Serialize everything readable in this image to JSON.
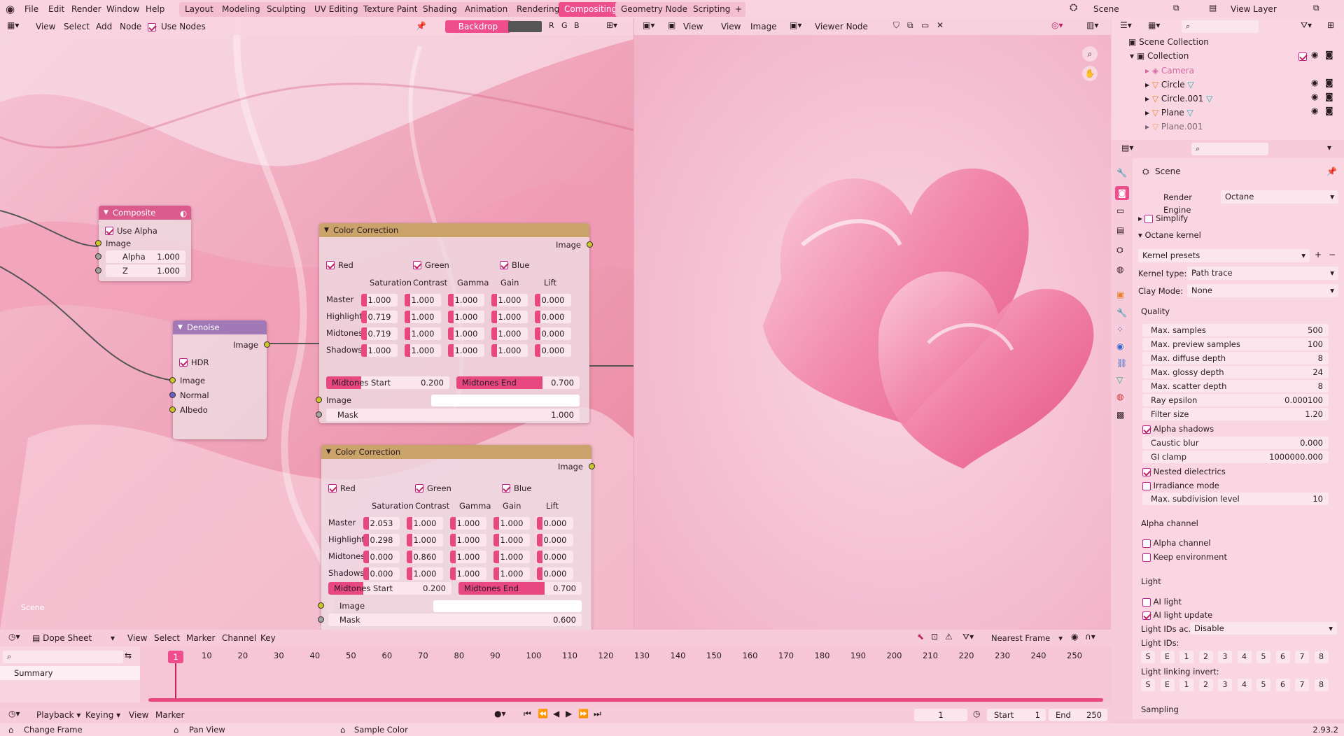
{
  "menubar": {
    "items": [
      "File",
      "Edit",
      "Render",
      "Window",
      "Help"
    ],
    "workspaces": [
      "Layout",
      "Modeling",
      "Sculpting",
      "UV Editing",
      "Texture Paint",
      "Shading",
      "Animation",
      "Rendering",
      "Compositing",
      "Geometry Nodes",
      "Scripting"
    ],
    "active_workspace": "Compositing",
    "scene_name": "Scene",
    "view_layer": "View Layer"
  },
  "node_editor": {
    "menus": [
      "View",
      "Select",
      "Add",
      "Node"
    ],
    "use_nodes_label": "Use Nodes",
    "backdrop_label": "Backdrop",
    "channel_buttons": [
      "R",
      "G",
      "B"
    ],
    "scene_label": "Scene"
  },
  "image_editor": {
    "menus": [
      "View",
      "View",
      "Image"
    ],
    "viewer_node": "Viewer Node"
  },
  "composite_node": {
    "title": "Composite",
    "use_alpha": "Use Alpha",
    "image": "Image",
    "alpha_label": "Alpha",
    "alpha_value": "1.000",
    "z_label": "Z",
    "z_value": "1.000"
  },
  "denoise_node": {
    "title": "Denoise",
    "out_image": "Image",
    "hdr": "HDR",
    "inputs": [
      "Image",
      "Normal",
      "Albedo"
    ]
  },
  "cc_nodes": [
    {
      "title": "Color Correction",
      "out_image": "Image",
      "channels": [
        "Red",
        "Green",
        "Blue"
      ],
      "columns": [
        "Saturation",
        "Contrast",
        "Gamma",
        "Gain",
        "Lift"
      ],
      "rows": [
        {
          "label": "Master",
          "values": [
            "1.000",
            "1.000",
            "1.000",
            "1.000",
            "0.000"
          ]
        },
        {
          "label": "Highlights",
          "values": [
            "0.719",
            "1.000",
            "1.000",
            "1.000",
            "0.000"
          ]
        },
        {
          "label": "Midtones",
          "values": [
            "0.719",
            "1.000",
            "1.000",
            "1.000",
            "0.000"
          ]
        },
        {
          "label": "Shadows",
          "values": [
            "1.000",
            "1.000",
            "1.000",
            "1.000",
            "0.000"
          ]
        }
      ],
      "midtones_start_label": "Midtones Start",
      "midtones_start": "0.200",
      "midtones_end_label": "Midtones End",
      "midtones_end": "0.700",
      "in_image": "Image",
      "mask_label": "Mask",
      "mask": "1.000"
    },
    {
      "title": "Color Correction",
      "out_image": "Image",
      "channels": [
        "Red",
        "Green",
        "Blue"
      ],
      "columns": [
        "Saturation",
        "Contrast",
        "Gamma",
        "Gain",
        "Lift"
      ],
      "rows": [
        {
          "label": "Master",
          "values": [
            "2.053",
            "1.000",
            "1.000",
            "1.000",
            "0.000"
          ]
        },
        {
          "label": "Highlights",
          "values": [
            "0.298",
            "1.000",
            "1.000",
            "1.000",
            "0.000"
          ]
        },
        {
          "label": "Midtones",
          "values": [
            "0.000",
            "0.860",
            "1.000",
            "1.000",
            "0.000"
          ]
        },
        {
          "label": "Shadows",
          "values": [
            "0.000",
            "1.000",
            "1.000",
            "1.000",
            "0.000"
          ]
        }
      ],
      "midtones_start_label": "Midtones Start",
      "midtones_start": "0.200",
      "midtones_end_label": "Midtones End",
      "midtones_end": "0.700",
      "in_image": "Image",
      "mask_label": "Mask",
      "mask": "0.600"
    }
  ],
  "outliner": {
    "scene_collection": "Scene Collection",
    "collection": "Collection",
    "items": [
      "Camera",
      "Circle",
      "Circle.001",
      "Plane",
      "Plane.001"
    ]
  },
  "properties": {
    "scene": "Scene",
    "render_engine_label": "Render Engine",
    "render_engine": "Octane",
    "simplify": "Simplify",
    "octane_kernel": "Octane kernel",
    "kernel_presets": "Kernel presets",
    "kernel_type_label": "Kernel type:",
    "kernel_type": "Path trace",
    "clay_mode_label": "Clay Mode:",
    "clay_mode": "None",
    "quality": "Quality",
    "quality_rows": [
      {
        "label": "Max. samples",
        "value": "500"
      },
      {
        "label": "Max. preview samples",
        "value": "100"
      },
      {
        "label": "Max. diffuse depth",
        "value": "8"
      },
      {
        "label": "Max. glossy depth",
        "value": "24"
      },
      {
        "label": "Max. scatter depth",
        "value": "8"
      },
      {
        "label": "Ray epsilon",
        "value": "0.000100"
      },
      {
        "label": "Filter size",
        "value": "1.20"
      }
    ],
    "alpha_shadows": "Alpha shadows",
    "caustic_blur_label": "Caustic blur",
    "caustic_blur": "0.000",
    "gi_clamp_label": "GI clamp",
    "gi_clamp": "1000000.000",
    "nested_dielectrics": "Nested dielectrics",
    "irradiance_mode": "Irradiance mode",
    "max_subdiv_label": "Max. subdivision level",
    "max_subdiv": "10",
    "alpha_channel_header": "Alpha channel",
    "alpha_channel": "Alpha channel",
    "keep_environment": "Keep environment",
    "light_header": "Light",
    "ai_light": "AI light",
    "ai_light_update": "AI light update",
    "light_ids_ac_label": "Light IDs ac...",
    "light_ids_ac": "Disable",
    "light_ids_label": "Light IDs:",
    "light_linking_label": "Light linking invert:",
    "light_keys": [
      "S",
      "E",
      "1",
      "2",
      "3",
      "4",
      "5",
      "6",
      "7",
      "8"
    ],
    "sampling": "Sampling"
  },
  "dopesheet": {
    "mode": "Dope Sheet",
    "menus": [
      "View",
      "Select",
      "Marker",
      "Channel",
      "Key"
    ],
    "snap": "Nearest Frame",
    "summary": "Summary",
    "ticks": [
      "10",
      "20",
      "30",
      "40",
      "50",
      "60",
      "70",
      "80",
      "90",
      "100",
      "110",
      "120",
      "130",
      "140",
      "150",
      "160",
      "170",
      "180",
      "190",
      "200",
      "210",
      "220",
      "230",
      "240",
      "250"
    ],
    "current_frame": "1"
  },
  "timeline": {
    "playback": "Playback",
    "keying": "Keying",
    "menus": [
      "View",
      "Marker"
    ],
    "frame": "1",
    "start_label": "Start",
    "start": "1",
    "end_label": "End",
    "end": "250"
  },
  "statusbar": {
    "change_frame": "Change Frame",
    "pan_view": "Pan View",
    "sample_color": "Sample Color",
    "version": "2.93.2"
  }
}
